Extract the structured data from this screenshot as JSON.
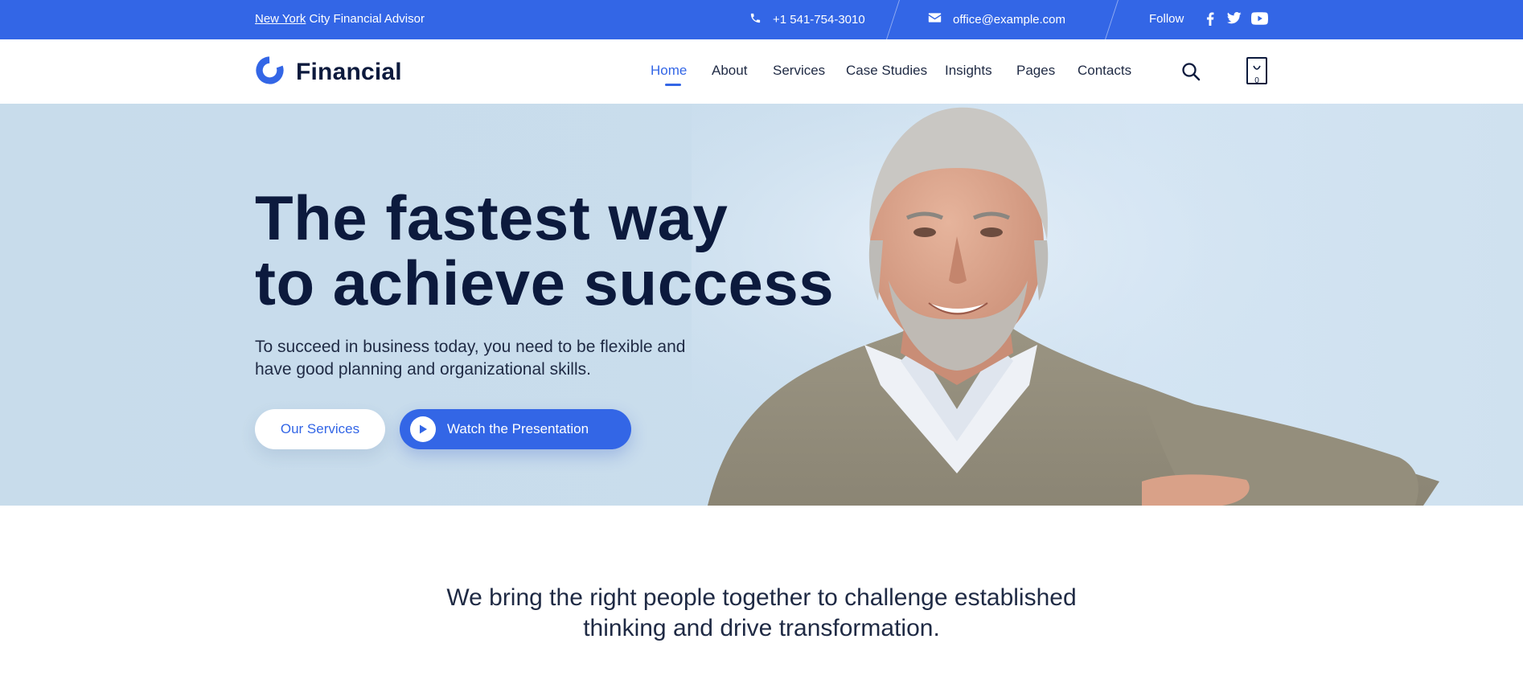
{
  "topbar": {
    "location_city": "New York",
    "location_rest": "City Financial Advisor",
    "phone": "+1 541-754-3010",
    "email": "office@example.com",
    "follow_label": "Follow",
    "social": [
      "facebook-icon",
      "twitter-icon",
      "youtube-icon"
    ],
    "bg_color": "#3366e6"
  },
  "header": {
    "logo_text": "Financial",
    "nav": [
      {
        "label": "Home",
        "active": true
      },
      {
        "label": "About",
        "active": false
      },
      {
        "label": "Services",
        "active": false
      },
      {
        "label": "Case Studies",
        "active": false
      },
      {
        "label": "Insights",
        "active": false
      },
      {
        "label": "Pages",
        "active": false
      },
      {
        "label": "Contacts",
        "active": false
      }
    ],
    "cart_count": "0",
    "accent_color": "#3366e6"
  },
  "hero": {
    "title_line1": "The fastest way",
    "title_line2": "to achieve success",
    "subtitle_line1": "To succeed in business today, you need to be flexible and",
    "subtitle_line2": "have good planning and organizational skills.",
    "primary_button": "Our Services",
    "secondary_button": "Watch the Presentation"
  },
  "statement": {
    "line1": "We bring the right people together to challenge established",
    "line2": "thinking and drive transformation."
  }
}
